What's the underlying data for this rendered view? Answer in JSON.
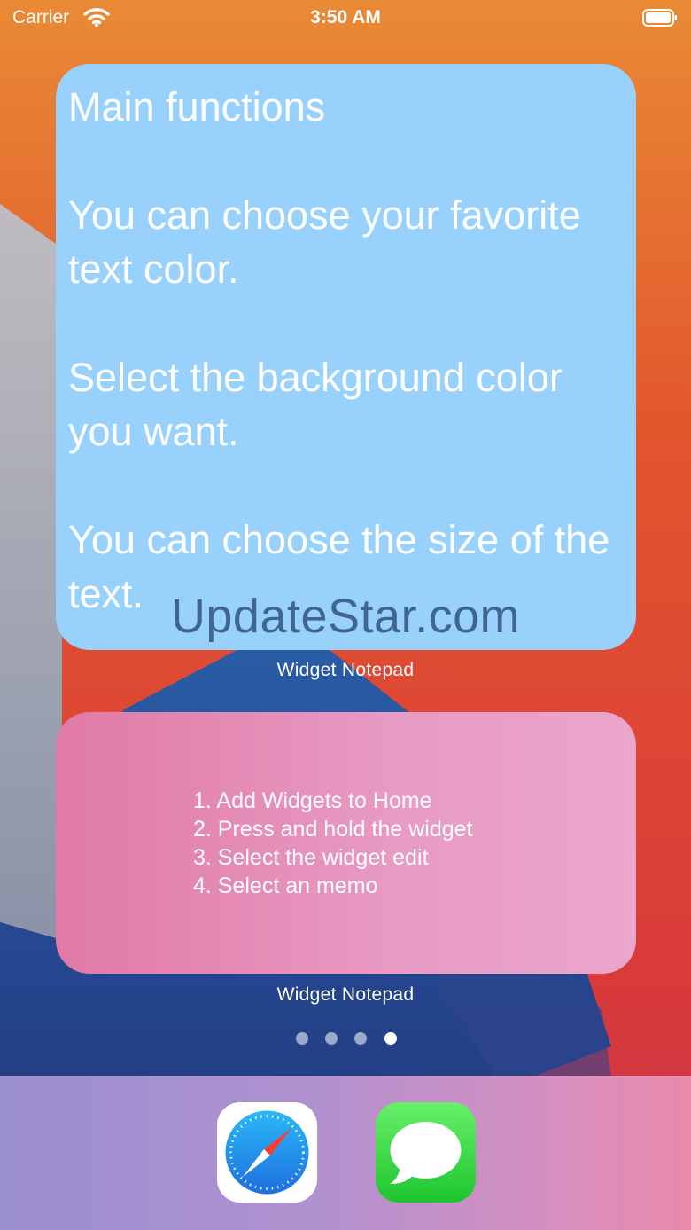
{
  "status_bar": {
    "carrier": "Carrier",
    "time": "3:50 AM"
  },
  "widgets": [
    {
      "note_text": "Main functions\n\nYou can choose your favorite text color.\n\nSelect the background color you want.\n\nYou can choose the size of the text.",
      "background_color": "#98d1fc",
      "label": "Widget Notepad"
    },
    {
      "steps": [
        "1. Add Widgets to Home",
        "2. Press and hold the widget",
        "3. Select the widget edit",
        "4. Select an memo"
      ],
      "background_color": "#e89bc4",
      "label": "Widget Notepad"
    }
  ],
  "watermark": "UpdateStar.com",
  "page_dots": {
    "count": 4,
    "active_index": 3
  },
  "dock": {
    "apps": [
      {
        "name": "Safari",
        "icon": "compass-icon"
      },
      {
        "name": "Messages",
        "icon": "speech-bubble-icon"
      }
    ]
  }
}
